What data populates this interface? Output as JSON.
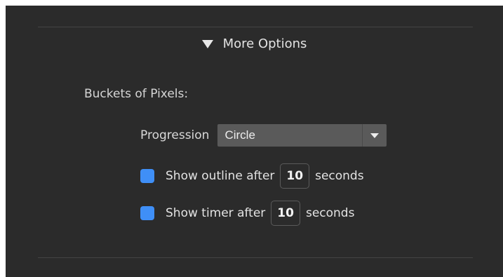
{
  "more_options": {
    "label": "More Options",
    "expanded": true
  },
  "section": {
    "title": "Buckets of Pixels:"
  },
  "progression": {
    "label": "Progression",
    "value": "Circle"
  },
  "outline": {
    "label_before": "Show outline after",
    "value": "10",
    "label_after": "seconds",
    "checked": true
  },
  "timer": {
    "label_before": "Show timer after",
    "value": "10",
    "label_after": "seconds",
    "checked": true
  },
  "colors": {
    "panel_bg": "#2b2b2b",
    "checkbox_accent": "#3f8ff7",
    "select_bg": "#5a5a5a"
  }
}
